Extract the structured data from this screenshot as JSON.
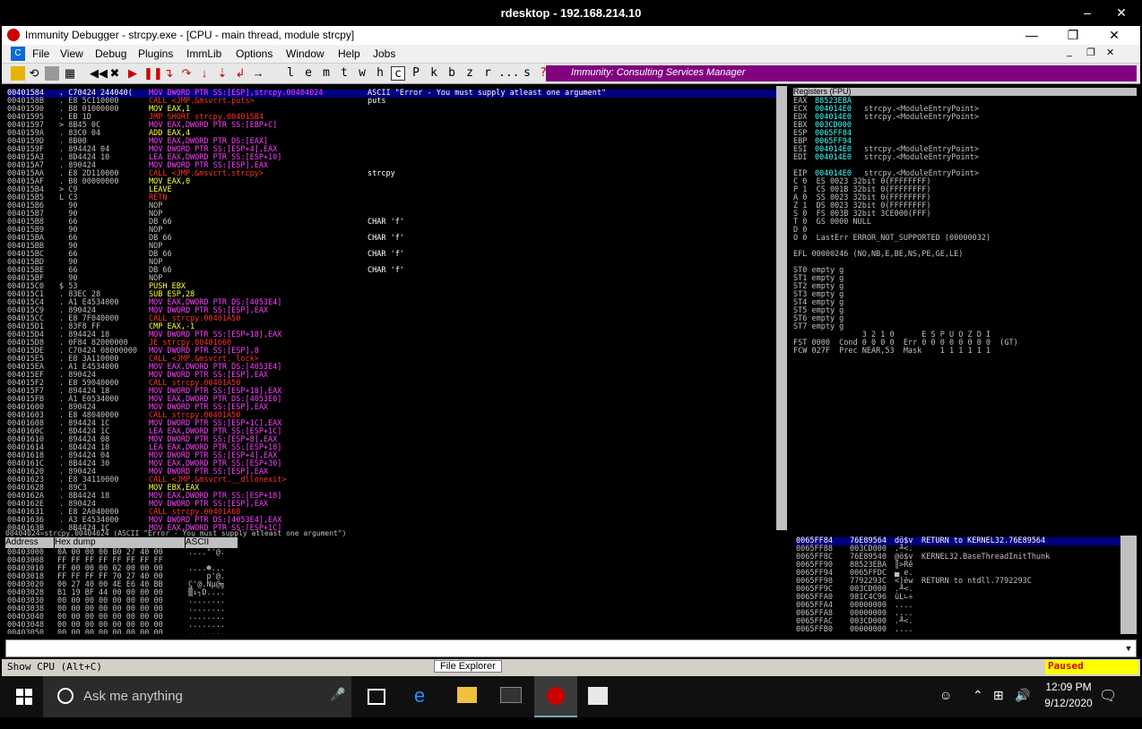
{
  "rdp_title": "rdesktop - 192.168.214.10",
  "imm_title": "Immunity Debugger - strcpy.exe - [CPU - main thread, module strcpy]",
  "menu": [
    "File",
    "View",
    "Debug",
    "Plugins",
    "ImmLib",
    "Options",
    "Window",
    "Help",
    "Jobs"
  ],
  "toolbar_letters": [
    "l",
    "e",
    "m",
    "t",
    "w",
    "h",
    "c",
    "P",
    "k",
    "b",
    "z",
    "r",
    "...",
    "s",
    "?"
  ],
  "banner": "Immunity: Consulting Services Manager",
  "disasm": [
    [
      "00401584",
      ". C70424 244040(",
      "MOV DWORD PTR SS:[ESP],strcpy.00404024",
      "ASCII \"Error - You must supply atleast one argument\""
    ],
    [
      "0040158B",
      ". E8 5C110000",
      "CALL <JMP.&msvcrt.puts>",
      "puts"
    ],
    [
      "00401590",
      ". B8 01000000",
      "MOV EAX,1",
      ""
    ],
    [
      "00401595",
      ". EB 1D",
      "JMP SHORT strcpy.004015B4",
      ""
    ],
    [
      "00401597",
      "> 8B45 0C",
      "MOV EAX,DWORD PTR SS:[EBP+C]",
      ""
    ],
    [
      "0040159A",
      ". 83C0 04",
      "ADD EAX,4",
      ""
    ],
    [
      "0040159D",
      ". 8B00",
      "MOV EAX,DWORD PTR DS:[EAX]",
      ""
    ],
    [
      "0040159F",
      ". 894424 04",
      "MOV DWORD PTR SS:[ESP+4],EAX",
      ""
    ],
    [
      "004015A3",
      ". 8D4424 10",
      "LEA EAX,DWORD PTR SS:[ESP+10]",
      ""
    ],
    [
      "004015A7",
      ". 890424",
      "MOV DWORD PTR SS:[ESP],EAX",
      ""
    ],
    [
      "004015AA",
      ". E8 2D110000",
      "CALL <JMP.&msvcrt.strcpy>",
      "strcpy"
    ],
    [
      "004015AF",
      ". B8 00000000",
      "MOV EAX,0",
      ""
    ],
    [
      "004015B4",
      "> C9",
      "LEAVE",
      ""
    ],
    [
      "004015B5",
      "L C3",
      "RETN",
      ""
    ],
    [
      "004015B6",
      "  90",
      "NOP",
      ""
    ],
    [
      "004015B7",
      "  90",
      "NOP",
      ""
    ],
    [
      "004015B8",
      "  66",
      "DB 66",
      "CHAR 'f'"
    ],
    [
      "004015B9",
      "  90",
      "NOP",
      ""
    ],
    [
      "004015BA",
      "  66",
      "DB 66",
      "CHAR 'f'"
    ],
    [
      "004015BB",
      "  90",
      "NOP",
      ""
    ],
    [
      "004015BC",
      "  66",
      "DB 66",
      "CHAR 'f'"
    ],
    [
      "004015BD",
      "  90",
      "NOP",
      ""
    ],
    [
      "004015BE",
      "  66",
      "DB 66",
      "CHAR 'f'"
    ],
    [
      "004015BF",
      "  90",
      "NOP",
      ""
    ],
    [
      "004015C0",
      "$ 53",
      "PUSH EBX",
      ""
    ],
    [
      "004015C1",
      ". 83EC 28",
      "SUB ESP,28",
      ""
    ],
    [
      "004015C4",
      ". A1 E4534000",
      "MOV EAX,DWORD PTR DS:[4053E4]",
      ""
    ],
    [
      "004015C9",
      ". 890424",
      "MOV DWORD PTR SS:[ESP],EAX",
      ""
    ],
    [
      "004015CC",
      ". E8 7F040000",
      "CALL strcpy.00401A50",
      ""
    ],
    [
      "004015D1",
      ". 83F8 FF",
      "CMP EAX,-1",
      ""
    ],
    [
      "004015D4",
      ". 894424 18",
      "MOV DWORD PTR SS:[ESP+18],EAX",
      ""
    ],
    [
      "004015D8",
      ". 0F84 82000000",
      "JE strcpy.00401660",
      ""
    ],
    [
      "004015DE",
      ". C70424 08000000",
      "MOV DWORD PTR SS:[ESP],8",
      ""
    ],
    [
      "004015E5",
      ". E8 3A110000",
      "CALL <JMP.&msvcrt._lock>",
      ""
    ],
    [
      "004015EA",
      ". A1 E4534000",
      "MOV EAX,DWORD PTR DS:[4053E4]",
      ""
    ],
    [
      "004015EF",
      ". 890424",
      "MOV DWORD PTR SS:[ESP],EAX",
      ""
    ],
    [
      "004015F2",
      ". E8 59040000",
      "CALL strcpy.00401A50",
      ""
    ],
    [
      "004015F7",
      ". 894424 18",
      "MOV DWORD PTR SS:[ESP+18],EAX",
      ""
    ],
    [
      "004015FB",
      ". A1 E0534000",
      "MOV EAX,DWORD PTR DS:[4053E0]",
      ""
    ],
    [
      "00401600",
      ". 890424",
      "MOV DWORD PTR SS:[ESP],EAX",
      ""
    ],
    [
      "00401603",
      ". E8 48040000",
      "CALL strcpy.00401A50",
      ""
    ],
    [
      "00401608",
      ". 894424 1C",
      "MOV DWORD PTR SS:[ESP+1C],EAX",
      ""
    ],
    [
      "0040160C",
      ". 8D4424 1C",
      "LEA EAX,DWORD PTR SS:[ESP+1C]",
      ""
    ],
    [
      "00401610",
      ". 894424 08",
      "MOV DWORD PTR SS:[ESP+8],EAX",
      ""
    ],
    [
      "00401614",
      ". 8D4424 18",
      "LEA EAX,DWORD PTR SS:[ESP+18]",
      ""
    ],
    [
      "00401618",
      ". 894424 04",
      "MOV DWORD PTR SS:[ESP+4],EAX",
      ""
    ],
    [
      "0040161C",
      ". 8B4424 30",
      "MOV EAX,DWORD PTR SS:[ESP+30]",
      ""
    ],
    [
      "00401620",
      ". 890424",
      "MOV DWORD PTR SS:[ESP],EAX",
      ""
    ],
    [
      "00401623",
      ". E8 34110000",
      "CALL <JMP.&msvcrt.__dllonexit>",
      ""
    ],
    [
      "00401628",
      ". 89C3",
      "MOV EBX,EAX",
      ""
    ],
    [
      "0040162A",
      ". 8B4424 18",
      "MOV EAX,DWORD PTR SS:[ESP+18]",
      ""
    ],
    [
      "0040162E",
      ". 890424",
      "MOV DWORD PTR SS:[ESP],EAX",
      ""
    ],
    [
      "00401631",
      ". E8 2A040000",
      "CALL strcpy.00401A60",
      ""
    ],
    [
      "00401636",
      ". A3 E4534000",
      "MOV DWORD PTR DS:[4053E4],EAX",
      ""
    ],
    [
      "0040163B",
      ". 8B4424 1C",
      "MOV EAX,DWORD PTR SS:[ESP+1C]",
      ""
    ]
  ],
  "info_line": "00404024=strcpy.00404024 (ASCII \"Error - You must supply atleast one argument\")",
  "registers_title": "Registers (FPU)",
  "registers": [
    [
      "EAX",
      "88523EBA",
      ""
    ],
    [
      "ECX",
      "004014E0",
      "strcpy.<ModuleEntryPoint>"
    ],
    [
      "EDX",
      "004014E0",
      "strcpy.<ModuleEntryPoint>"
    ],
    [
      "EBX",
      "003CD000",
      ""
    ],
    [
      "ESP",
      "0065FF84",
      ""
    ],
    [
      "EBP",
      "0065FF94",
      ""
    ],
    [
      "ESI",
      "004014E0",
      "strcpy.<ModuleEntryPoint>"
    ],
    [
      "EDI",
      "004014E0",
      "strcpy.<ModuleEntryPoint>"
    ],
    [
      "",
      "",
      " "
    ],
    [
      "EIP",
      "004014E0",
      "strcpy.<ModuleEntryPoint>"
    ]
  ],
  "flags": [
    "C 0  ES 0023 32bit 0(FFFFFFFF)",
    "P 1  CS 001B 32bit 0(FFFFFFFF)",
    "A 0  SS 0023 32bit 0(FFFFFFFF)",
    "Z 1  DS 0023 32bit 0(FFFFFFFF)",
    "S 0  FS 003B 32bit 3CE000(FFF)",
    "T 0  GS 0000 NULL",
    "D 0",
    "O 0  LastErr ERROR_NOT_SUPPORTED (00000032)",
    "",
    "EFL 00000246 (NO,NB,E,BE,NS,PE,GE,LE)",
    "",
    "ST0 empty g",
    "ST1 empty g",
    "ST2 empty g",
    "ST3 empty g",
    "ST4 empty g",
    "ST5 empty g",
    "ST6 empty g",
    "ST7 empty g",
    "               3 2 1 0      E S P U O Z D I",
    "FST 0000  Cond 0 0 0 0  Err 0 0 0 0 0 0 0 0  (GT)",
    "FCW 027F  Prec NEAR,53  Mask    1 1 1 1 1 1"
  ],
  "dump_headers": [
    "Address",
    "Hex dump",
    "ASCII"
  ],
  "dump": [
    [
      "00403000",
      "0A 00 00 00 B0 27 40 00",
      "....°'@."
    ],
    [
      "00403008",
      "FF FF FF FF FF FF FF FF",
      ""
    ],
    [
      "00403010",
      "FF 00 00 00 02 00 00 00",
      "....☻..."
    ],
    [
      "00403018",
      "FF FF FF FF 70 27 40 00",
      "    p'@."
    ],
    [
      "00403020",
      "00 27 40 00 4E E6 40 BB",
      "Ç'@.Nµ@╗"
    ],
    [
      "00403028",
      "B1 19 BF 44 00 00 00 00",
      "▒↓┐D...."
    ],
    [
      "00403030",
      "00 00 00 00 00 00 00 00",
      "........"
    ],
    [
      "00403038",
      "00 00 00 00 00 00 00 00",
      "........"
    ],
    [
      "00403040",
      "00 00 00 00 00 00 00 00",
      "........"
    ],
    [
      "00403048",
      "00 00 00 00 00 00 00 00",
      "........"
    ],
    [
      "00403050",
      "00 00 00 00 00 00 00 00",
      "........"
    ]
  ],
  "stack": [
    [
      "0065FF84",
      "76E89564",
      "dö$v",
      "RETURN to KERNEL32.76E89564"
    ],
    [
      "0065FF88",
      "003CD000",
      ".╨<.",
      ""
    ],
    [
      "0065FF8C",
      "76E89540",
      "@ö$v",
      "KERNEL32.BaseThreadInitThunk"
    ],
    [
      "0065FF90",
      "88523EBA",
      "║>Rê",
      ""
    ],
    [
      "0065FF94",
      "0065FFDC",
      "▄ e.",
      ""
    ],
    [
      "0065FF98",
      "7792293C",
      "<)ëw",
      "RETURN to ntdll.7792293C"
    ],
    [
      "0065FF9C",
      "003CD000",
      ".╨<.",
      ""
    ],
    [
      "0065FFA0",
      "981C4C96",
      "ûL∟÷",
      ""
    ],
    [
      "0065FFA4",
      "00000000",
      "....",
      ""
    ],
    [
      "0065FFA8",
      "00000000",
      "....",
      ""
    ],
    [
      "0065FFAC",
      "003CD000",
      ".╨<.",
      ""
    ],
    [
      "0065FFB0",
      "00000000",
      "....",
      ""
    ]
  ],
  "status_left": "Show CPU (Alt+C)",
  "tooltip": "File Explorer",
  "status_right": "Paused",
  "taskbar": {
    "search": "Ask me anything",
    "time": "12:09 PM",
    "date": "9/12/2020"
  }
}
